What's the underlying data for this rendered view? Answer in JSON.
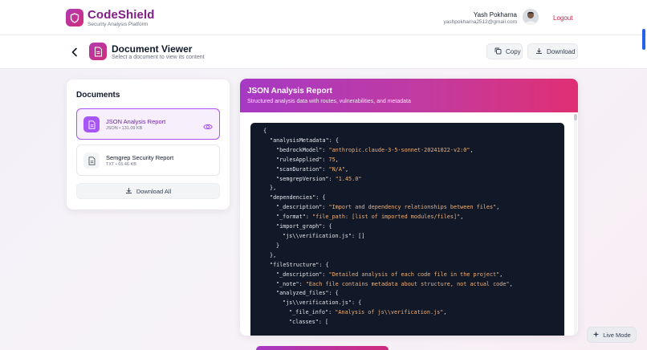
{
  "app": {
    "brand": "CodeShield",
    "tagline": "Security Analysis Platform"
  },
  "user": {
    "name": "Yash Pokharna",
    "email": "yashpokharna2512@gmail.com",
    "logout_label": "Logout"
  },
  "viewer": {
    "title": "Document Viewer",
    "subtitle": "Select a document to view its content",
    "copy_label": "Copy",
    "download_label": "Download"
  },
  "documents": {
    "title": "Documents",
    "items": [
      {
        "name": "JSON Analysis Report",
        "meta": "JSON • 131.09 KB",
        "selected": true
      },
      {
        "name": "Semgrep Security Report",
        "meta": "TXT • 65.46 KB",
        "selected": false
      }
    ],
    "download_all_label": "Download All"
  },
  "report": {
    "title": "JSON Analysis Report",
    "subtitle": "Structured analysis data with routes, vulnerabilities, and metadata",
    "lines": [
      {
        "indent": 0,
        "text": "{"
      },
      {
        "indent": 1,
        "key": "\"analysisMetadata\"",
        "text": ": {"
      },
      {
        "indent": 2,
        "key": "\"bedrockModel\"",
        "value": "\"anthropic.claude-3-5-sonnet-20241022-v2:0\"",
        "text": ","
      },
      {
        "indent": 2,
        "key": "\"rulesApplied\"",
        "value": "75",
        "text": ","
      },
      {
        "indent": 2,
        "key": "\"scanDuration\"",
        "value": "\"N/A\"",
        "text": ","
      },
      {
        "indent": 2,
        "key": "\"semgrepVersion\"",
        "value": "\"1.45.0\"",
        "text": ""
      },
      {
        "indent": 1,
        "text": "},"
      },
      {
        "indent": 1,
        "key": "\"dependencies\"",
        "text": ": {"
      },
      {
        "indent": 2,
        "key": "\"_description\"",
        "value": "\"Import and dependency relationships between files\"",
        "text": ","
      },
      {
        "indent": 2,
        "key": "\"_format\"",
        "value": "\"file_path: [list of imported modules/files]\"",
        "text": ","
      },
      {
        "indent": 2,
        "key": "\"import_graph\"",
        "text": ": {"
      },
      {
        "indent": 3,
        "key": "\"js\\\\verification.js\"",
        "text": ": []"
      },
      {
        "indent": 2,
        "text": "}"
      },
      {
        "indent": 1,
        "text": "},"
      },
      {
        "indent": 1,
        "key": "\"fileStructure\"",
        "text": ": {"
      },
      {
        "indent": 2,
        "key": "\"_description\"",
        "value": "\"Detailed analysis of each code file in the project\"",
        "text": ","
      },
      {
        "indent": 2,
        "key": "\"_note\"",
        "value": "\"Each file contains metadata about structure, not actual code\"",
        "text": ","
      },
      {
        "indent": 2,
        "key": "\"analyzed_files\"",
        "text": ": {"
      },
      {
        "indent": 3,
        "key": "\"js\\\\verification.js\"",
        "text": ": {"
      },
      {
        "indent": 4,
        "key": "\"_file_info\"",
        "value": "\"Analysis of js\\\\verification.js\"",
        "text": ","
      },
      {
        "indent": 4,
        "key": "\"classes\"",
        "text": ": ["
      }
    ]
  },
  "live_mode_label": "Live Mode",
  "colors": {
    "brand_purple": "#7e1f86",
    "accent_gradient_start": "#a639c4",
    "accent_gradient_end": "#e02f73",
    "logout_red": "#c8264a",
    "code_bg": "#111827",
    "code_string": "#f0b27a"
  }
}
